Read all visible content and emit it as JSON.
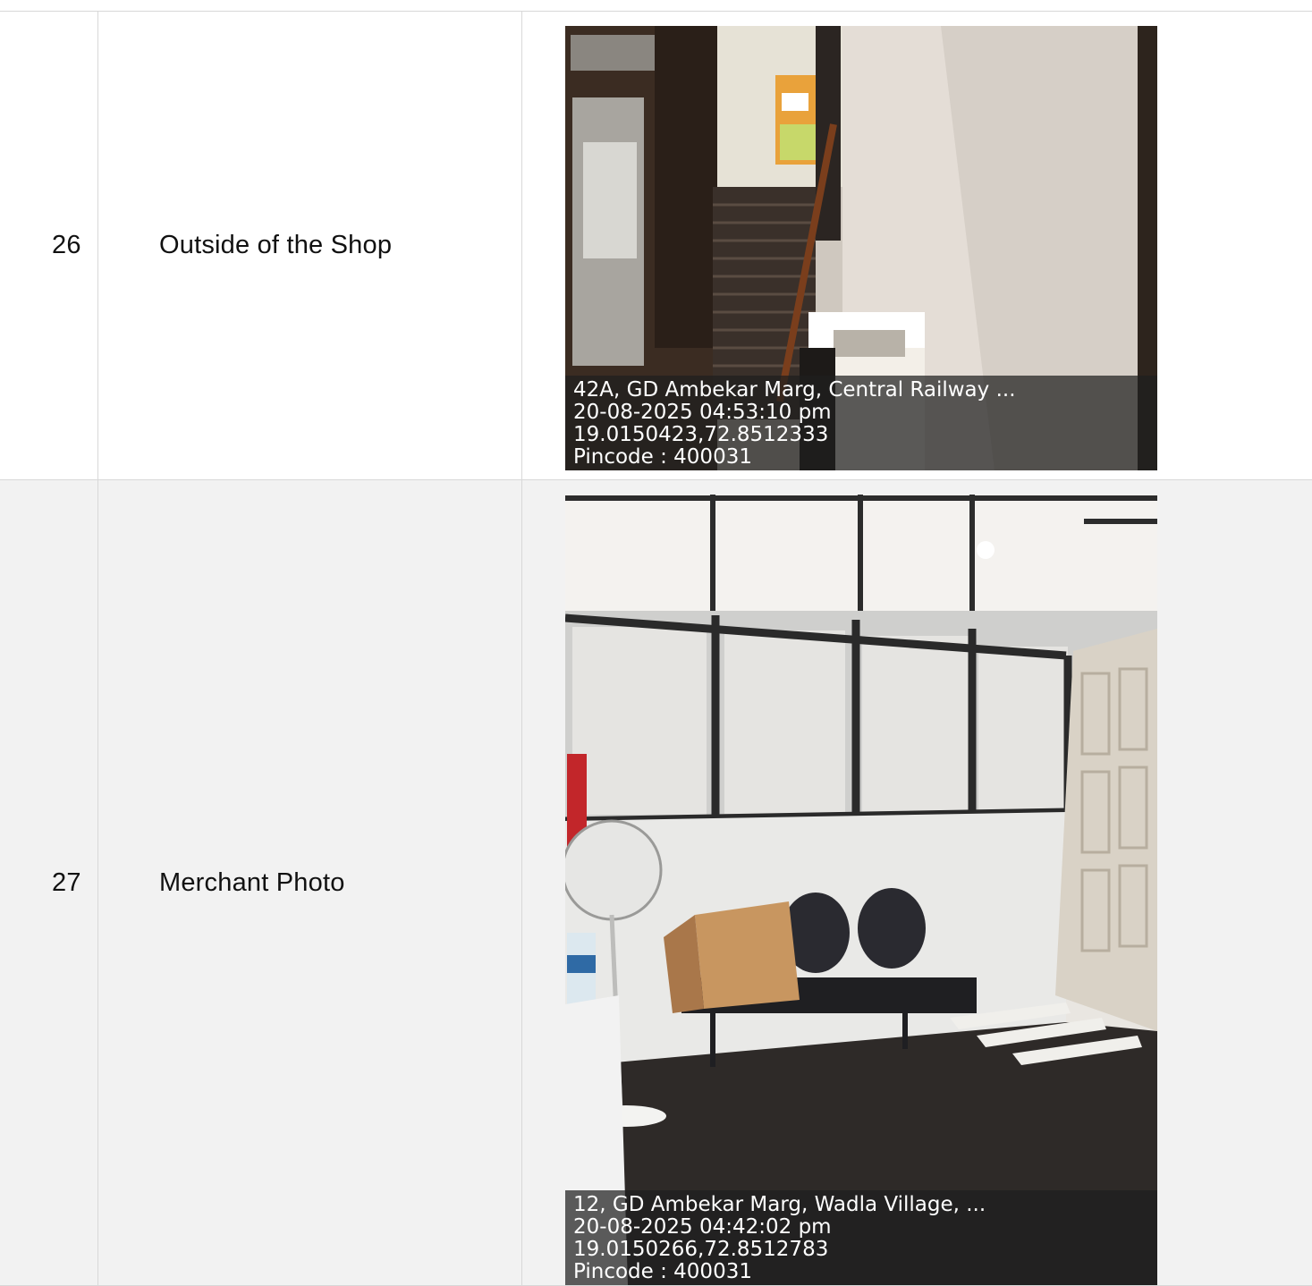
{
  "rows": [
    {
      "number": "26",
      "label": "Outside of the Shop",
      "photo": {
        "address": "42A, GD Ambekar Marg, Central Railway ...",
        "datetime": "20-08-2025 04:53:10 pm",
        "coordinates": "19.0150423,72.8512333",
        "pincode": "Pincode : 400031"
      }
    },
    {
      "number": "27",
      "label": "Merchant Photo",
      "photo": {
        "address": "12, GD Ambekar Marg, Wadla Village, ...",
        "datetime": "20-08-2025 04:42:02 pm",
        "coordinates": "19.0150266,72.8512783",
        "pincode": "Pincode : 400031"
      }
    }
  ]
}
